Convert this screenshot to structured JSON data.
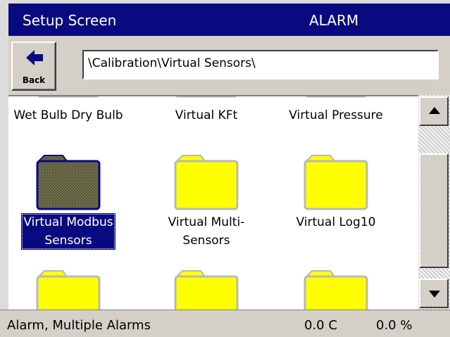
{
  "titlebar": {
    "title": "Setup Screen",
    "alarm": "ALARM"
  },
  "toolbar": {
    "back_label": "Back",
    "path": "\\Calibration\\Virtual Sensors\\"
  },
  "folders": [
    {
      "name": "Wet Bulb Dry Bulb"
    },
    {
      "name": "Virtual KFt"
    },
    {
      "name": "Virtual Pressure"
    },
    {
      "name": "Virtual Modbus Sensors",
      "line1": "Virtual Modbus",
      "line2": "Sensors",
      "selected": true
    },
    {
      "name": "Virtual Multi-Sensors",
      "line1": "Virtual Multi-",
      "line2": "Sensors"
    },
    {
      "name": "Virtual Log10"
    }
  ],
  "colors": {
    "titlebar": "#0a0a80",
    "folder": "#ffff00",
    "folder_outline": "#b8b8b8",
    "selection": "#0a0a80"
  },
  "icons": {
    "back": "left-arrow-icon",
    "folder": "folder-icon",
    "scroll_up": "scroll-up-arrow-icon",
    "scroll_down": "scroll-down-arrow-icon"
  },
  "status": {
    "message": "Alarm, Multiple Alarms",
    "temperature": "0.0 C",
    "percent": "0.0 %"
  }
}
